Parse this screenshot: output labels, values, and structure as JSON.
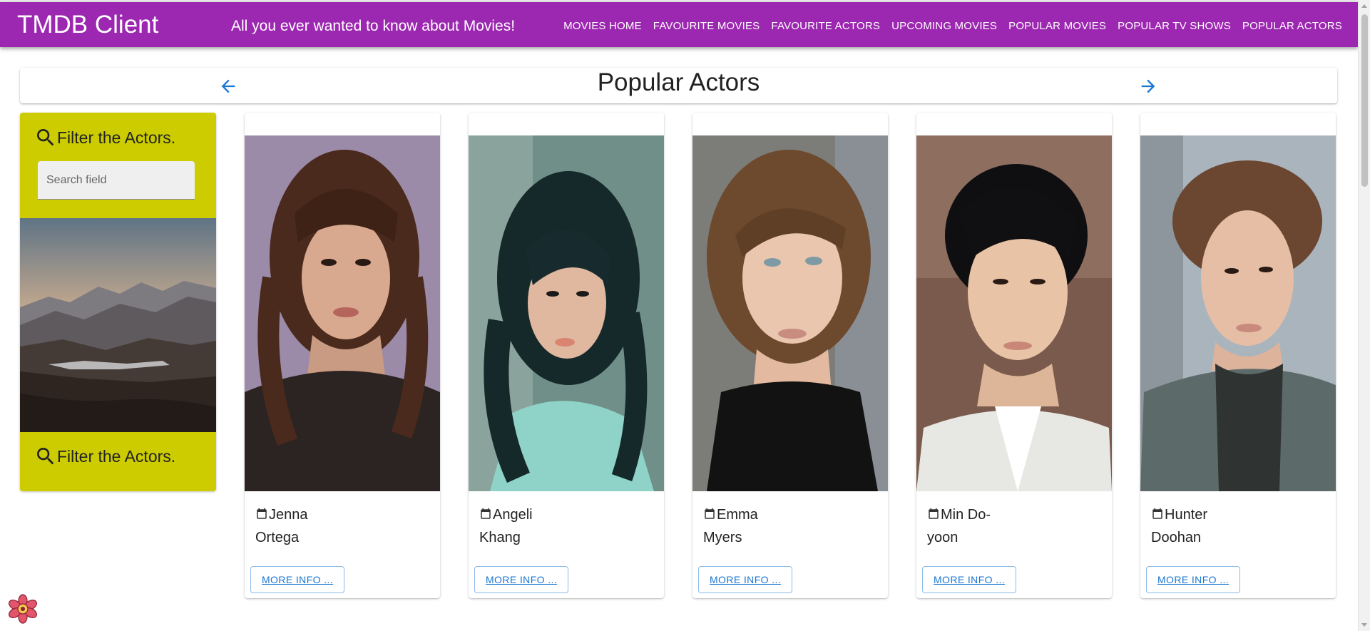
{
  "app": {
    "brand": "TMDB Client",
    "tagline": "All you ever wanted to know about Movies!",
    "accent": "#9c27b0"
  },
  "nav": {
    "items": [
      {
        "label": "MOVIES HOME"
      },
      {
        "label": "FAVOURITE MOVIES"
      },
      {
        "label": "FAVOURITE ACTORS"
      },
      {
        "label": "UPCOMING MOVIES"
      },
      {
        "label": "POPULAR MOVIES"
      },
      {
        "label": "POPULAR TV SHOWS"
      },
      {
        "label": "POPULAR ACTORS"
      }
    ]
  },
  "pager": {
    "title": "Popular Actors",
    "prev_icon": "arrow-back-icon",
    "next_icon": "arrow-forward-icon"
  },
  "filter": {
    "heading": "Filter the Actors.",
    "footer": "Filter the Actors.",
    "search_placeholder": "Search field",
    "search_value": "",
    "panel_color": "#cccc00",
    "icon": "search-icon"
  },
  "actors": [
    {
      "first": "Jenna",
      "last": "Ortega",
      "button": "MORE INFO ..."
    },
    {
      "first": "Angeli",
      "last": "Khang",
      "button": "MORE INFO ..."
    },
    {
      "first": "Emma",
      "last": "Myers",
      "button": "MORE INFO ..."
    },
    {
      "first": "Min Do-",
      "last": "yoon",
      "button": "MORE INFO ..."
    },
    {
      "first": "Hunter",
      "last": "Doohan",
      "button": "MORE INFO ..."
    }
  ],
  "fab": {
    "icon": "react-devtools-icon"
  }
}
